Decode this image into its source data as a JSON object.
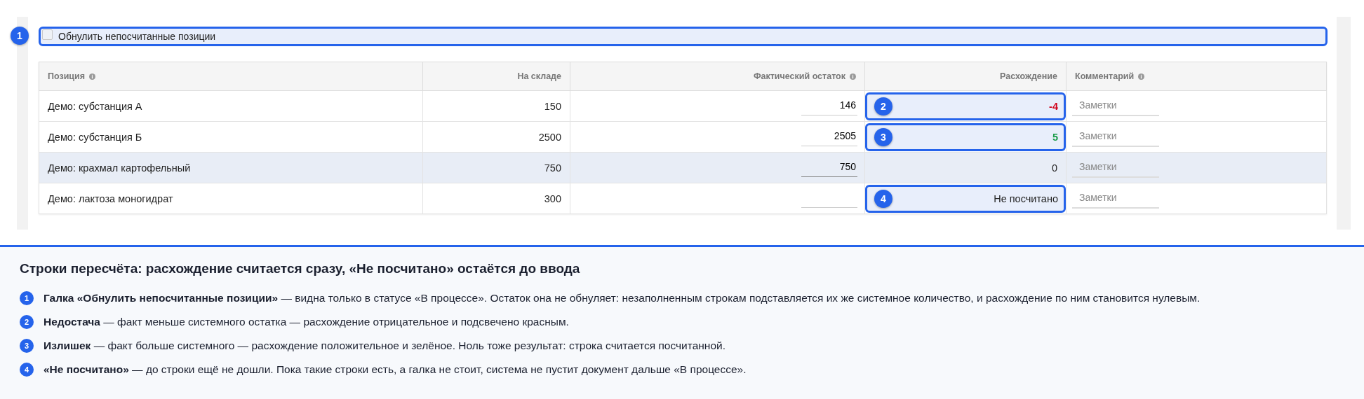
{
  "reset_option": {
    "label": "Обнулить непосчитанные позиции",
    "checked": false,
    "callout": "1"
  },
  "table": {
    "columns": [
      {
        "label": "Позиция",
        "info": true
      },
      {
        "label": "На складе",
        "info": false
      },
      {
        "label": "Фактический остаток",
        "info": true
      },
      {
        "label": "Расхождение",
        "info": false
      },
      {
        "label": "Комментарий",
        "info": true
      }
    ],
    "rows": [
      {
        "name": "Демо: субстанция А",
        "stock": "150",
        "actual": "146",
        "diff": "-4",
        "kind": "negative",
        "highlighted": false,
        "callout": "2",
        "comment_placeholder": "Заметки"
      },
      {
        "name": "Демо: субстанция Б",
        "stock": "2500",
        "actual": "2505",
        "diff": "5",
        "kind": "positive",
        "highlighted": false,
        "callout": "3",
        "comment_placeholder": "Заметки"
      },
      {
        "name": "Демо: крахмал картофельный",
        "stock": "750",
        "actual": "750",
        "diff": "0",
        "kind": "zero",
        "highlighted": true,
        "comment_placeholder": "Заметки"
      },
      {
        "name": "Демо: лактоза моногидрат",
        "stock": "300",
        "diff": "Не посчитано",
        "kind": "uncounted",
        "highlighted": false,
        "callout": "4",
        "comment_placeholder": "Заметки"
      }
    ]
  },
  "legend": {
    "title": "Строки пересчёта: расхождение считается сразу, «Не посчитано» остаётся до ввода",
    "items": [
      {
        "number": "1",
        "text": "**Галка «Обнулить непосчитанные позиции»** — видна только в статусе «В процессе». Остаток она не обнуляет: незаполненным строкам подставляется их же системное количество, и расхождение по ним становится нулевым."
      },
      {
        "number": "2",
        "text": "**Недостача** — факт меньше системного остатка — расхождение отрицательное и подсвечено красным."
      },
      {
        "number": "3",
        "text": "**Излишек** — факт больше системного — расхождение положительное и зелёное. Ноль тоже результат: строка считается посчитанной."
      },
      {
        "number": "4",
        "text": "**«Не посчитано»** — до строки ещё не дошли. Пока такие строки есть, а галка не стоит, система не пустит документ дальше «В процессе»."
      }
    ]
  }
}
